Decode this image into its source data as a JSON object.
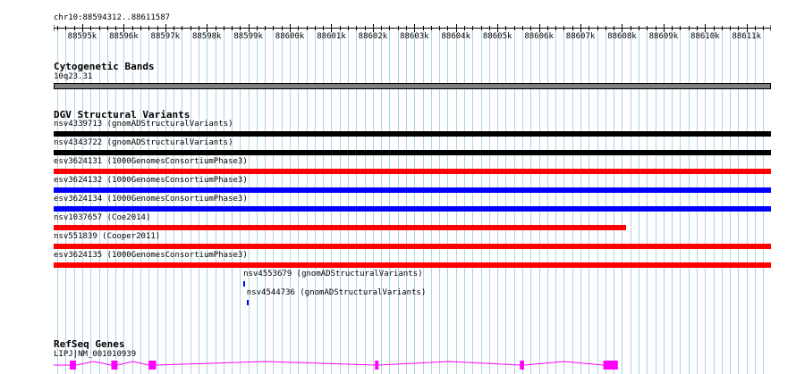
{
  "location": "chr10:88594312..88611587",
  "ruler": {
    "start": 88594312,
    "end": 88611587,
    "tick_labels": [
      "88595k",
      "88596k",
      "88597k",
      "88598k",
      "88599k",
      "88600k",
      "88601k",
      "88602k",
      "88603k",
      "88604k",
      "88605k",
      "88606k",
      "88607k",
      "88608k",
      "88609k",
      "88610k",
      "88611k"
    ]
  },
  "cytoband_track": {
    "title": "Cytogenetic Bands",
    "band_label": "10q23.31",
    "color": "#7f7f7f"
  },
  "dgv_track": {
    "title": "DGV Structural Variants",
    "features": [
      {
        "label": "nsv4339713 (gnomADStructuralVariants)",
        "color": "#000000",
        "start": 88594312,
        "end": 88611587
      },
      {
        "label": "nsv4343722 (gnomADStructuralVariants)",
        "color": "#000000",
        "start": 88594312,
        "end": 88611587
      },
      {
        "label": "esv3624131 (1000GenomesConsortiumPhase3)",
        "color": "#ff0000",
        "start": 88594312,
        "end": 88611587
      },
      {
        "label": "esv3624132 (1000GenomesConsortiumPhase3)",
        "color": "#0000ff",
        "start": 88594312,
        "end": 88611587
      },
      {
        "label": "esv3624134 (1000GenomesConsortiumPhase3)",
        "color": "#0000ff",
        "start": 88594312,
        "end": 88611587
      },
      {
        "label": "nsv1037657 (Coe2014)",
        "color": "#ff0000",
        "start": 88594312,
        "end": 88608100
      },
      {
        "label": "nsv551839 (Cooper2011)",
        "color": "#ff0000",
        "start": 88594312,
        "end": 88611587
      },
      {
        "label": "esv3624135 (1000GenomesConsortiumPhase3)",
        "color": "#ff0000",
        "start": 88594312,
        "end": 88611587
      },
      {
        "label": "nsv4553679 (gnomADStructuralVariants)",
        "color": "#0000ff",
        "start": 88598880,
        "end": 88598920
      },
      {
        "label": "nsv4544736 (gnomADStructuralVariants)",
        "color": "#0000ff",
        "start": 88598960,
        "end": 88599000
      }
    ]
  },
  "refseq_track": {
    "title": "RefSeq Genes",
    "gene_label": "LIPJ|NM_001010939",
    "color": "#ff00ff",
    "exons": [
      [
        88594700,
        88594850
      ],
      [
        88595700,
        88595850
      ],
      [
        88596600,
        88596780
      ],
      [
        88602050,
        88602130
      ],
      [
        88605540,
        88605640
      ],
      [
        88607550,
        88607900
      ]
    ]
  }
}
